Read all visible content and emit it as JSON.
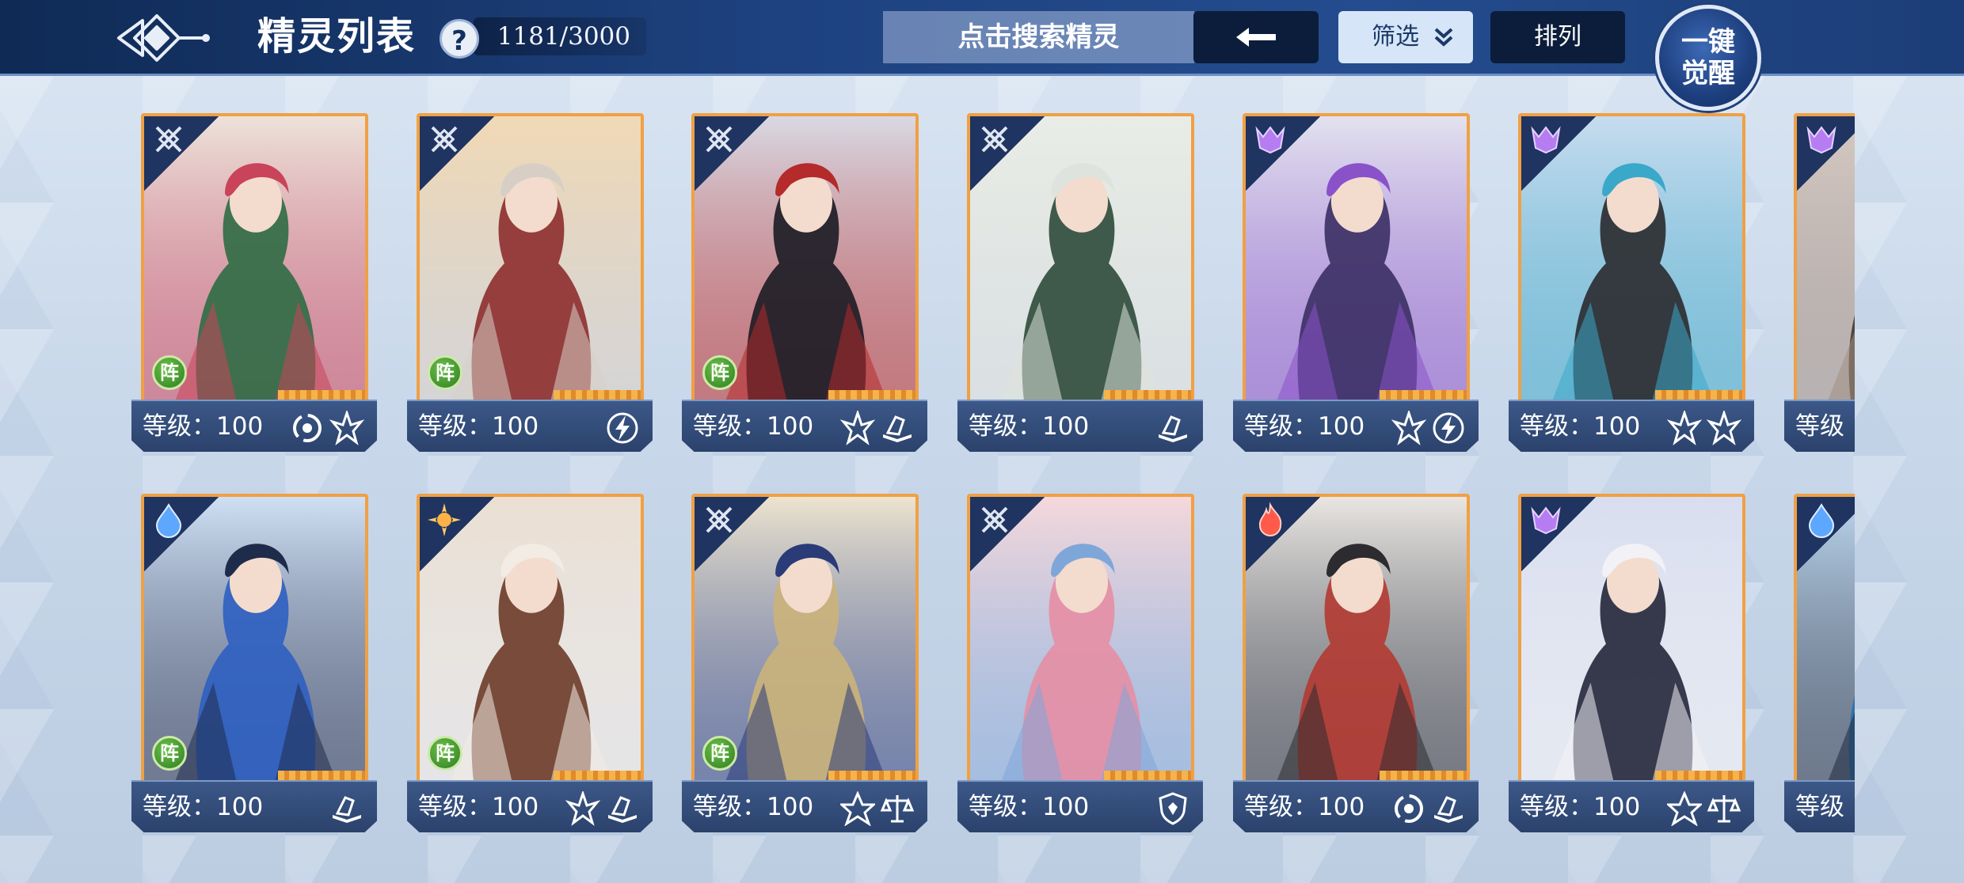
{
  "header": {
    "title": "精灵列表",
    "help_label": "?",
    "count": "1181/3000",
    "search_placeholder": "点击搜索精灵",
    "filter_label": "筛选",
    "sort_label": "排列",
    "awaken_line1": "一键",
    "awaken_line2": "觉醒"
  },
  "level_prefix": "等级：",
  "formation_badge": "阵",
  "cards": [
    {
      "level": "等级：100",
      "corner": "neutral-icon",
      "formation": true,
      "palette": [
        "#ede2da",
        "#2f6b45",
        "#c9435a"
      ],
      "elements": [
        "swirl-icon",
        "spiky-icon"
      ]
    },
    {
      "level": "等级：100",
      "corner": "neutral-icon",
      "formation": true,
      "palette": [
        "#f1d9b5",
        "#8d2d2d",
        "#d7cfc6"
      ],
      "elements": [
        "lightning-icon"
      ]
    },
    {
      "level": "等级：100",
      "corner": "neutral-icon",
      "formation": true,
      "palette": [
        "#d9d9e3",
        "#1b1b24",
        "#b52a2a"
      ],
      "elements": [
        "spiky-icon",
        "book-icon"
      ]
    },
    {
      "level": "等级：100",
      "corner": "neutral-icon",
      "formation": false,
      "palette": [
        "#e9ede6",
        "#2e4a38",
        "#dfe3dd"
      ],
      "elements": [
        "book-icon"
      ]
    },
    {
      "level": "等级：100",
      "corner": "demon-icon",
      "formation": false,
      "palette": [
        "#e3e2ef",
        "#3b2f64",
        "#8a52c9"
      ],
      "elements": [
        "spiky-icon",
        "lightning-icon"
      ]
    },
    {
      "level": "等级：100",
      "corner": "demon-icon",
      "formation": false,
      "palette": [
        "#c7dcef",
        "#2a2a2e",
        "#3aa8c9"
      ],
      "elements": [
        "spiky-icon",
        "spiky-icon"
      ]
    },
    {
      "level": "等级",
      "corner": "demon-icon",
      "formation": false,
      "palette": [
        "#d5c9c2",
        "#4a3a32",
        "#a08f84"
      ],
      "elements": []
    },
    {
      "level": "等级：100",
      "corner": "water-icon",
      "formation": true,
      "palette": [
        "#cfe0f4",
        "#2d5fc1",
        "#1f2b4a"
      ],
      "elements": [
        "book-icon"
      ]
    },
    {
      "level": "等级：100",
      "corner": "light-icon",
      "formation": true,
      "palette": [
        "#eadfd3",
        "#6b3a28",
        "#f2ece4"
      ],
      "elements": [
        "spiky-icon",
        "book-icon"
      ]
    },
    {
      "level": "等级：100",
      "corner": "neutral-icon",
      "formation": true,
      "palette": [
        "#ece4cf",
        "#cbb27a",
        "#2a3b78"
      ],
      "elements": [
        "star-icon",
        "scale-icon"
      ]
    },
    {
      "level": "等级：100",
      "corner": "neutral-icon",
      "formation": false,
      "palette": [
        "#f5d8dc",
        "#e58ea4",
        "#7fa6d8"
      ],
      "elements": [
        "shield-icon"
      ]
    },
    {
      "level": "等级：100",
      "corner": "fire-icon",
      "formation": false,
      "palette": [
        "#e9e6e2",
        "#b23a32",
        "#2b2b30"
      ],
      "elements": [
        "swirl-icon",
        "book-icon"
      ]
    },
    {
      "level": "等级：100",
      "corner": "demon-icon",
      "formation": false,
      "palette": [
        "#d8def0",
        "#24263a",
        "#f2f2f6"
      ],
      "elements": [
        "star-icon",
        "scale-icon"
      ]
    },
    {
      "level": "等级",
      "corner": "water-icon",
      "formation": false,
      "palette": [
        "#bcd7ee",
        "#2e6ea8",
        "#1d2a40"
      ],
      "elements": []
    }
  ],
  "colors": {
    "topbar": "#1e4280",
    "card_border": "#f0a044",
    "level_bar": "#2b426c",
    "formation_green": "#3f9a2e"
  }
}
